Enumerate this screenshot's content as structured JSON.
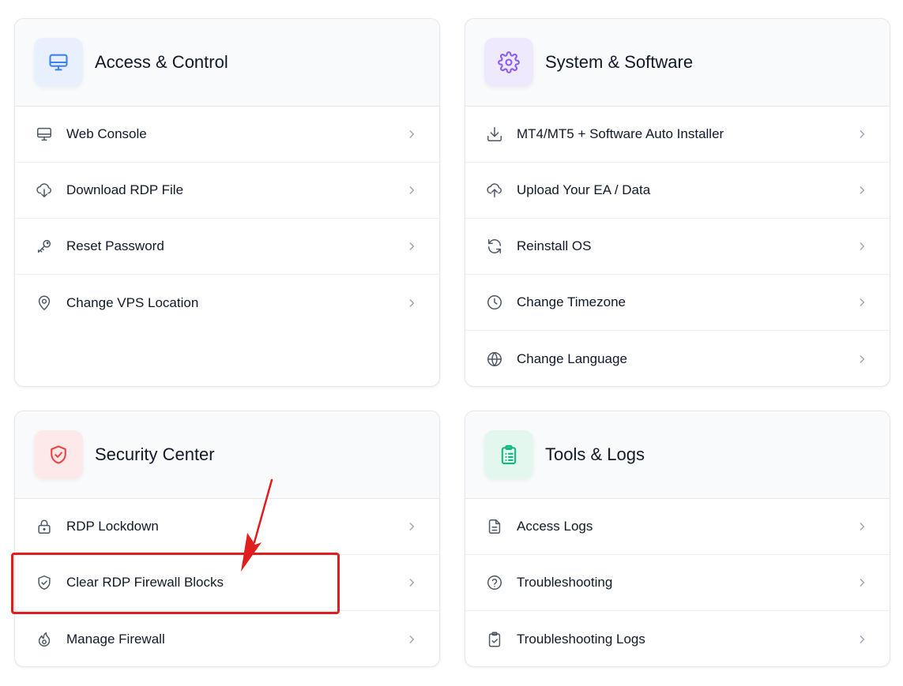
{
  "cards": {
    "access": {
      "title": "Access & Control",
      "icon": "monitor-icon",
      "icon_color": "#3b82f6",
      "icon_bg": "#e8f0fd",
      "items": [
        {
          "label": "Web Console",
          "icon": "monitor-icon"
        },
        {
          "label": "Download RDP File",
          "icon": "cloud-download-icon"
        },
        {
          "label": "Reset Password",
          "icon": "key-icon"
        },
        {
          "label": "Change VPS Location",
          "icon": "map-pin-icon"
        }
      ]
    },
    "system": {
      "title": "System & Software",
      "icon": "gear-icon",
      "icon_color": "#8b5cf6",
      "icon_bg": "#efe9fd",
      "items": [
        {
          "label": "MT4/MT5 + Software Auto Installer",
          "icon": "download-icon"
        },
        {
          "label": "Upload Your EA / Data",
          "icon": "cloud-upload-icon"
        },
        {
          "label": "Reinstall OS",
          "icon": "refresh-icon"
        },
        {
          "label": "Change Timezone",
          "icon": "clock-icon"
        },
        {
          "label": "Change Language",
          "icon": "globe-icon"
        }
      ]
    },
    "security": {
      "title": "Security Center",
      "icon": "shield-check-icon",
      "icon_color": "#ef4444",
      "icon_bg": "#fde9e9",
      "items": [
        {
          "label": "RDP Lockdown",
          "icon": "lock-icon"
        },
        {
          "label": "Clear RDP Firewall Blocks",
          "icon": "shield-check-icon"
        },
        {
          "label": "Manage Firewall",
          "icon": "flame-icon"
        }
      ]
    },
    "tools": {
      "title": "Tools & Logs",
      "icon": "clipboard-list-icon",
      "icon_color": "#10b981",
      "icon_bg": "#e3f7ef",
      "items": [
        {
          "label": "Access Logs",
          "icon": "file-text-icon"
        },
        {
          "label": "Troubleshooting",
          "icon": "help-circle-icon"
        },
        {
          "label": "Troubleshooting Logs",
          "icon": "clipboard-check-icon"
        }
      ]
    }
  },
  "annotation": {
    "highlight_color": "#e11d1d"
  }
}
